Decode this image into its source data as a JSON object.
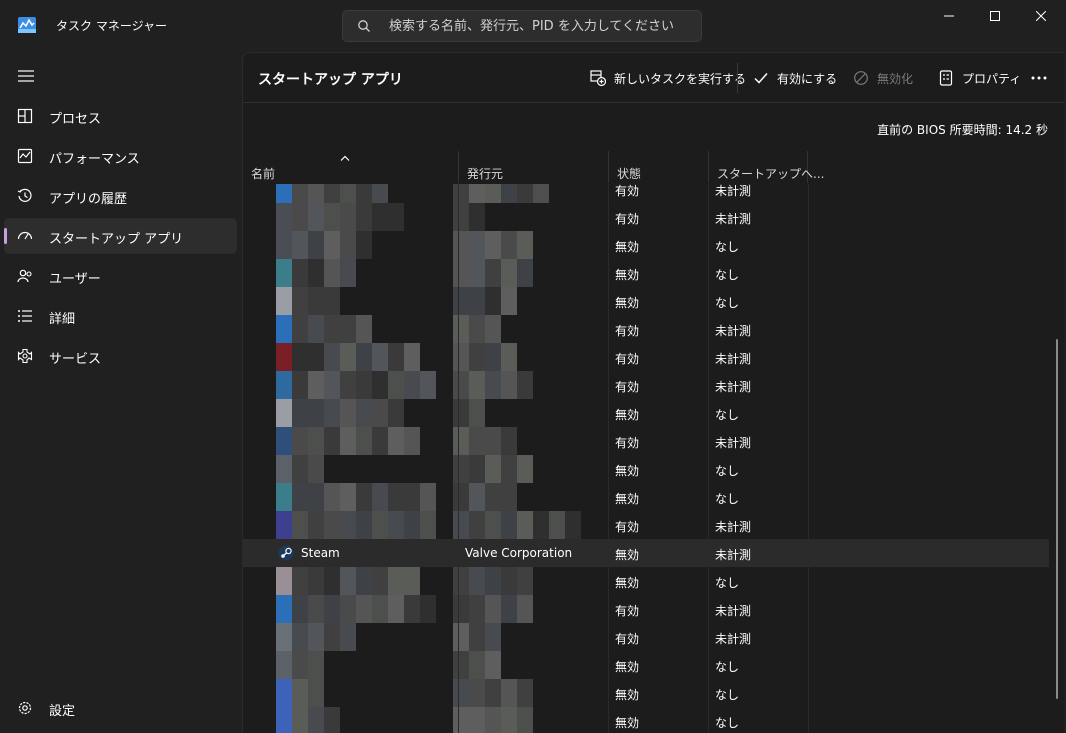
{
  "window": {
    "title": "タスク マネージャー",
    "search_placeholder": "検索する名前、発行元、PID を入力してください",
    "minimize_icon": "minimize-icon",
    "maximize_icon": "maximize-icon",
    "close_icon": "close-icon"
  },
  "sidebar": {
    "items": [
      {
        "label": "プロセス",
        "icon": "processes-icon"
      },
      {
        "label": "パフォーマンス",
        "icon": "performance-icon"
      },
      {
        "label": "アプリの履歴",
        "icon": "history-icon"
      },
      {
        "label": "スタートアップ アプリ",
        "icon": "startup-icon",
        "active": true
      },
      {
        "label": "ユーザー",
        "icon": "users-icon"
      },
      {
        "label": "詳細",
        "icon": "details-icon"
      },
      {
        "label": "サービス",
        "icon": "services-icon"
      }
    ],
    "settings_label": "設定"
  },
  "toolbar": {
    "title": "スタートアップ アプリ",
    "new_task_label": "新しいタスクを実行する",
    "enable_label": "有効にする",
    "disable_label": "無効化",
    "properties_label": "プロパティ"
  },
  "bios": {
    "label": "直前の BIOS 所要時間:",
    "value": "14.2 秒"
  },
  "table": {
    "columns": [
      "名前",
      "発行元",
      "状態",
      "スタートアップへ..."
    ],
    "rows": [
      {
        "name": "",
        "publisher": "",
        "status": "有効",
        "impact": "未計測"
      },
      {
        "name": "",
        "publisher": "",
        "status": "有効",
        "impact": "未計測"
      },
      {
        "name": "",
        "publisher": "",
        "status": "無効",
        "impact": "なし"
      },
      {
        "name": "",
        "publisher": "",
        "status": "無効",
        "impact": "なし"
      },
      {
        "name": "",
        "publisher": "",
        "status": "無効",
        "impact": "なし"
      },
      {
        "name": "",
        "publisher": "",
        "status": "有効",
        "impact": "未計測"
      },
      {
        "name": "",
        "publisher": "",
        "status": "有効",
        "impact": "未計測"
      },
      {
        "name": "",
        "publisher": "",
        "status": "有効",
        "impact": "未計測"
      },
      {
        "name": "",
        "publisher": "",
        "status": "無効",
        "impact": "なし"
      },
      {
        "name": "",
        "publisher": "",
        "status": "有効",
        "impact": "未計測"
      },
      {
        "name": "",
        "publisher": "",
        "status": "無効",
        "impact": "なし"
      },
      {
        "name": "",
        "publisher": "",
        "status": "無効",
        "impact": "なし"
      },
      {
        "name": "",
        "publisher": "",
        "status": "有効",
        "impact": "未計測"
      },
      {
        "name": "Steam",
        "publisher": "Valve Corporation",
        "status": "無効",
        "impact": "未計測",
        "selected": true,
        "icon": "steam-icon"
      },
      {
        "name": "",
        "publisher": "",
        "status": "無効",
        "impact": "なし"
      },
      {
        "name": "",
        "publisher": "",
        "status": "有効",
        "impact": "未計測"
      },
      {
        "name": "",
        "publisher": "",
        "status": "有効",
        "impact": "未計測"
      },
      {
        "name": "",
        "publisher": "",
        "status": "無効",
        "impact": "なし"
      },
      {
        "name": "",
        "publisher": "",
        "status": "無効",
        "impact": "なし"
      },
      {
        "name": "",
        "publisher": "",
        "status": "無効",
        "impact": "なし"
      }
    ]
  }
}
